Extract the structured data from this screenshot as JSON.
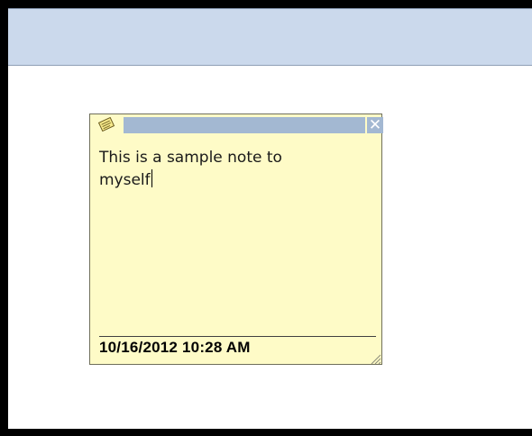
{
  "note": {
    "icon": "note-pad-icon",
    "close_glyph": "✕",
    "text": "This is a sample note to\nmyself",
    "timestamp": "10/16/2012 10:28 AM"
  },
  "colors": {
    "background_border": "#000000",
    "toolbar": "#cbd9ec",
    "note_background": "#fefbc7",
    "note_titlebar": "#a3b8d2"
  }
}
